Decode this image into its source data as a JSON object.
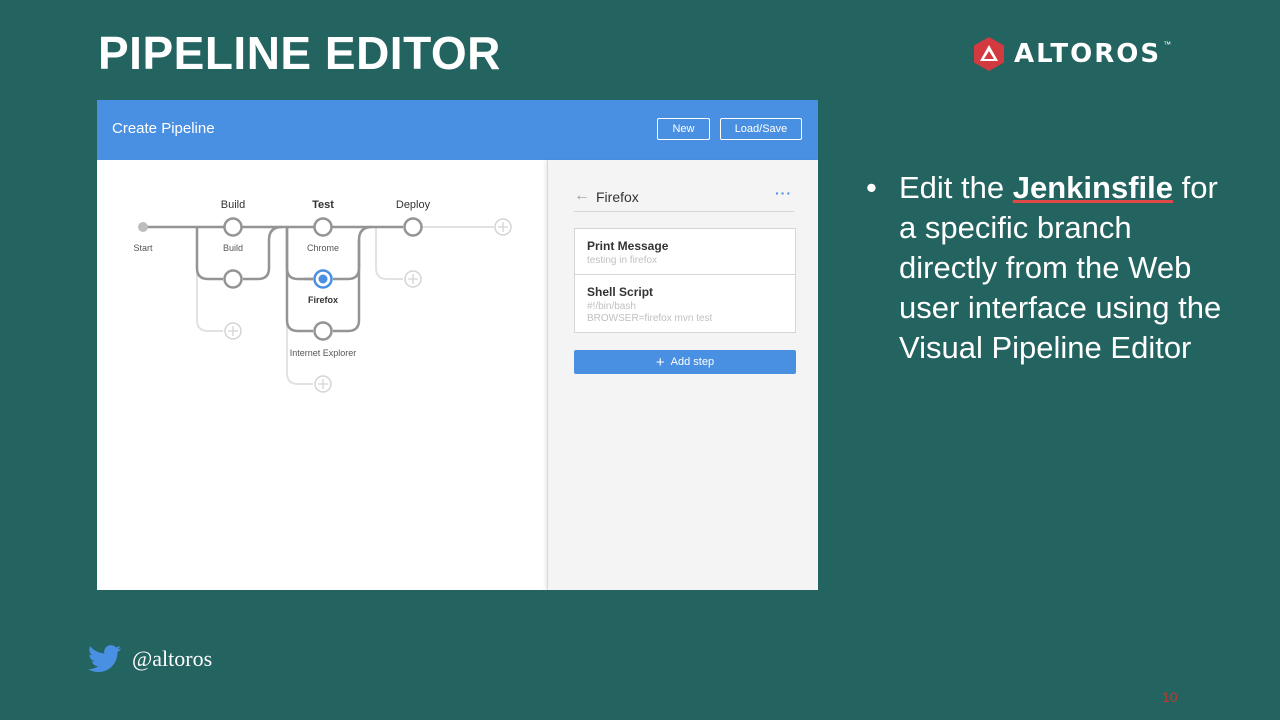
{
  "slide": {
    "title": "PIPELINE EDITOR",
    "logo_text": "ALTOROS",
    "logo_tm": "™",
    "twitter_handle": "@altoros",
    "page_number": "10",
    "bullet": {
      "before": "Edit the ",
      "keyword": "Jenkinsfile",
      "after": " for a specific branch directly from the Web user interface using the Visual Pipeline Editor"
    }
  },
  "editor": {
    "title": "Create Pipeline",
    "buttons": {
      "new": "New",
      "load_save": "Load/Save"
    },
    "stages": [
      "Build",
      "Test",
      "Deploy"
    ],
    "nodes": {
      "start": "Start",
      "build": "Build",
      "chrome": "Chrome",
      "firefox": "Firefox",
      "ie": "Internet Explorer"
    },
    "panel": {
      "title": "Firefox",
      "steps": [
        {
          "name": "Print Message",
          "lines": [
            "testing in firefox"
          ]
        },
        {
          "name": "Shell Script",
          "lines": [
            "#!/bin/bash",
            "BROWSER=firefox mvn test"
          ]
        }
      ],
      "add_step_label": "Add step"
    },
    "selected_node": "Firefox"
  },
  "colors": {
    "background": "#236360",
    "header": "#4a90e2",
    "accent": "#4a90e2",
    "logo_red": "#d33a3f",
    "page_number": "#c0392b",
    "twitter": "#4a90e2"
  }
}
